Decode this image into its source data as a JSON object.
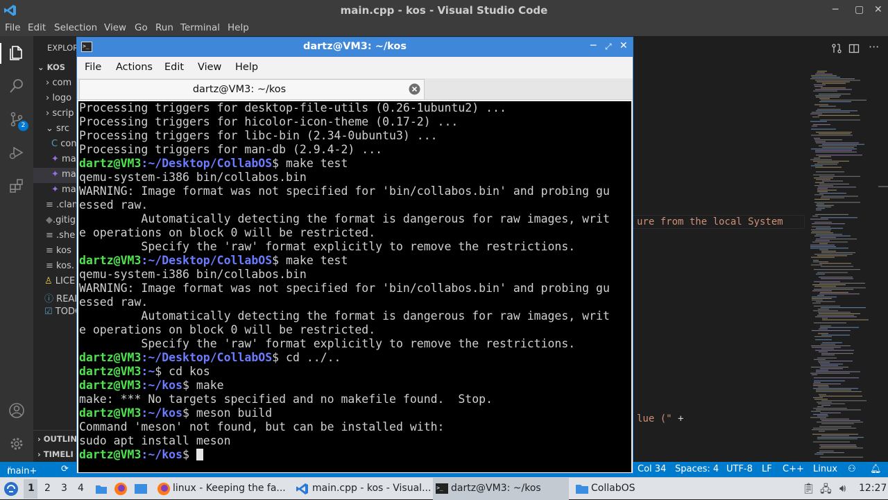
{
  "vscode": {
    "title": "main.cpp - kos - Visual Studio Code",
    "menu": [
      "File",
      "Edit",
      "Selection",
      "View",
      "Go",
      "Run",
      "Terminal",
      "Help"
    ],
    "scm_badge": "2",
    "explorer_label": "EXPLOR",
    "root_folder": "KOS",
    "tree": [
      "com",
      "logo",
      "scrip",
      "src",
      "con",
      "ma",
      "ma",
      "ma",
      ".clan",
      ".gitig",
      ".she",
      "kos",
      "kos.",
      "LICE",
      "REAI",
      "TODO"
    ],
    "outline_label": "OUTLIN",
    "timeline_label": "TIMELI",
    "code_fragment_1": "ure from the local System",
    "code_fragment_2_string": "lue (\"",
    "code_fragment_2_op": " +"
  },
  "status": {
    "branch": "main+",
    "position": "Col 34",
    "spaces": "Spaces: 4",
    "encoding": "UTF-8",
    "eol": "LF",
    "language": "C++",
    "os": "Linux"
  },
  "terminal": {
    "title": "dartz@VM3: ~/kos",
    "menu": [
      "File",
      "Actions",
      "Edit",
      "View",
      "Help"
    ],
    "tab_label": "dartz@VM3: ~/kos",
    "lines": [
      {
        "text": "Processing triggers for desktop-file-utils (0.26-1ubuntu2) ..."
      },
      {
        "text": "Processing triggers for hicolor-icon-theme (0.17-2) ..."
      },
      {
        "text": "Processing triggers for libc-bin (2.34-0ubuntu3) ..."
      },
      {
        "text": "Processing triggers for man-db (2.9.4-2) ..."
      },
      {
        "user": "dartz@VM3",
        "path": ":~/Desktop/CollabOS",
        "cmd": "$ make test"
      },
      {
        "text": "qemu-system-i386 bin/collabos.bin"
      },
      {
        "text": "WARNING: Image format was not specified for 'bin/collabos.bin' and probing gu"
      },
      {
        "text": "essed raw."
      },
      {
        "text": "         Automatically detecting the format is dangerous for raw images, writ"
      },
      {
        "text": "e operations on block 0 will be restricted."
      },
      {
        "text": "         Specify the 'raw' format explicitly to remove the restrictions."
      },
      {
        "user": "dartz@VM3",
        "path": ":~/Desktop/CollabOS",
        "cmd": "$ make test"
      },
      {
        "text": "qemu-system-i386 bin/collabos.bin"
      },
      {
        "text": "WARNING: Image format was not specified for 'bin/collabos.bin' and probing gu"
      },
      {
        "text": "essed raw."
      },
      {
        "text": "         Automatically detecting the format is dangerous for raw images, writ"
      },
      {
        "text": "e operations on block 0 will be restricted."
      },
      {
        "text": "         Specify the 'raw' format explicitly to remove the restrictions."
      },
      {
        "user": "dartz@VM3",
        "path": ":~/Desktop/CollabOS",
        "cmd": "$ cd ../.."
      },
      {
        "user": "dartz@VM3",
        "path": ":~",
        "cmd": "$ cd kos"
      },
      {
        "user": "dartz@VM3",
        "path": ":~/kos",
        "cmd": "$ make"
      },
      {
        "text": "make: *** No targets specified and no makefile found.  Stop."
      },
      {
        "user": "dartz@VM3",
        "path": ":~/kos",
        "cmd": "$ meson build"
      },
      {
        "text": "Command 'meson' not found, but can be installed with:"
      },
      {
        "text": "sudo apt install meson"
      },
      {
        "user": "dartz@VM3",
        "path": ":~/kos",
        "cmd": "$ ",
        "cursor": true
      }
    ]
  },
  "taskbar": {
    "workspaces": [
      "1",
      "2",
      "3",
      "4"
    ],
    "tasks": [
      {
        "label": "linux - Keeping the fa..."
      },
      {
        "label": "main.cpp - kos - Visual..."
      },
      {
        "label": "dartz@VM3: ~/kos"
      },
      {
        "label": "CollabOS"
      }
    ],
    "clock": "12:27"
  },
  "colors": {
    "statusbar": "#007acc",
    "terminal_titlebar": "#3f88d9",
    "prompt_user": "#4ee44e",
    "prompt_path": "#6b7cff"
  }
}
